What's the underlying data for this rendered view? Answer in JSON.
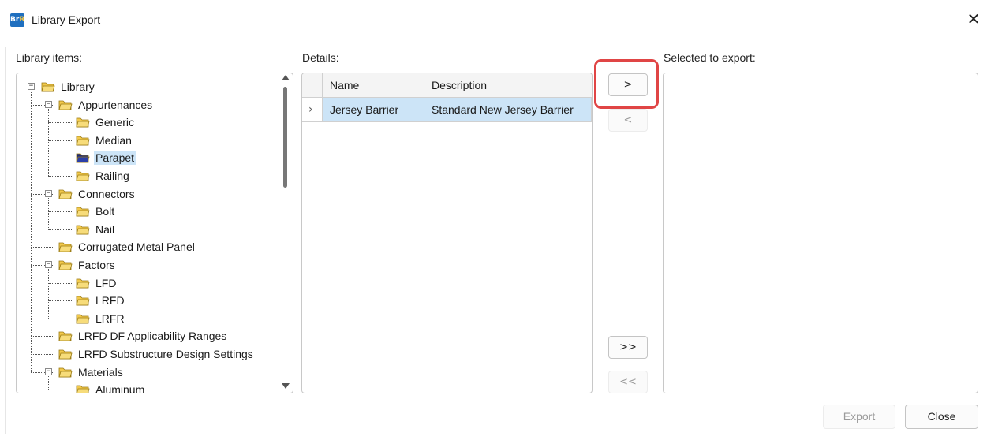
{
  "window": {
    "title": "Library Export",
    "logo_text_a": "Br",
    "logo_text_b": "R",
    "close_glyph": "✕"
  },
  "labels": {
    "library_items": "Library items:",
    "details": "Details:",
    "selected_to_export": "Selected to export:"
  },
  "tree": {
    "nodes": [
      {
        "label": "Library",
        "level": 0,
        "expanded": true,
        "open": true
      },
      {
        "label": "Appurtenances",
        "level": 1,
        "expanded": true,
        "open": true
      },
      {
        "label": "Generic",
        "level": 2
      },
      {
        "label": "Median",
        "level": 2
      },
      {
        "label": "Parapet",
        "level": 2,
        "selected": true
      },
      {
        "label": "Railing",
        "level": 2
      },
      {
        "label": "Connectors",
        "level": 1,
        "expanded": true,
        "open": true
      },
      {
        "label": "Bolt",
        "level": 2
      },
      {
        "label": "Nail",
        "level": 2
      },
      {
        "label": "Corrugated Metal Panel",
        "level": 1
      },
      {
        "label": "Factors",
        "level": 1,
        "expanded": true,
        "open": true
      },
      {
        "label": "LFD",
        "level": 2
      },
      {
        "label": "LRFD",
        "level": 2
      },
      {
        "label": "LRFR",
        "level": 2
      },
      {
        "label": "LRFD DF Applicability Ranges",
        "level": 1
      },
      {
        "label": "LRFD Substructure Design Settings",
        "level": 1
      },
      {
        "label": "Materials",
        "level": 1,
        "expanded": true,
        "open": true
      },
      {
        "label": "Aluminum",
        "level": 2
      }
    ]
  },
  "grid": {
    "columns": [
      "Name",
      "Description"
    ],
    "rows": [
      {
        "indicator": "›",
        "name": "Jersey Barrier",
        "description": "Standard New Jersey Barrier"
      }
    ]
  },
  "transfer": {
    "add_one": ">",
    "remove_one": "<",
    "add_all": ">>",
    "remove_all": "<<"
  },
  "footer": {
    "export_label": "Export",
    "close_label": "Close"
  },
  "colors": {
    "accent_highlight": "#e04545",
    "selection": "#cce4f7",
    "folder": "#f2c94c",
    "folder_selected": "#1c2a7a"
  },
  "icons": {
    "folder": "folder-icon",
    "folder_open": "folder-open-icon",
    "expander": "collapse-icon"
  }
}
